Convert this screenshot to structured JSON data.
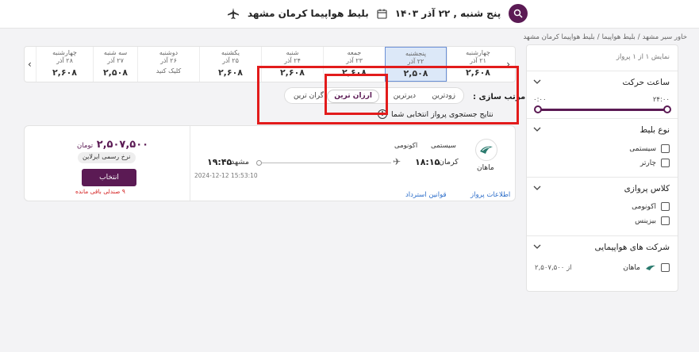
{
  "header": {
    "title": "بلیط هواپیما کرمان مشهد",
    "date": "پنج شنبه , ۲۲ آذر ۱۴۰۳"
  },
  "breadcrumb": [
    "خاور سیر مشهد",
    "/",
    "بلیط هواپیما",
    "/",
    "بلیط هواپیما کرمان مشهد"
  ],
  "datestrip": {
    "days": [
      {
        "name": "چهارشنبه",
        "date": "۲۱ آذر",
        "price": "۲,۶۰۸"
      },
      {
        "name": "پنجشنبه",
        "date": "۲۲ آذر",
        "price": "۲,۵۰۸",
        "active": true
      },
      {
        "name": "جمعه",
        "date": "۲۳ آذر",
        "price": "۲,۶۰۸"
      },
      {
        "name": "شنبه",
        "date": "۲۴ آذر",
        "price": "۲,۶۰۸"
      },
      {
        "name": "یکشنبه",
        "date": "۲۵ آذر",
        "price": "۲,۶۰۸"
      },
      {
        "name": "دوشنبه",
        "date": "۲۶ آذر",
        "price": "کلیک کنید",
        "small": true
      },
      {
        "name": "سه شنبه",
        "date": "۲۷ آذر",
        "price": "۲,۵۰۸"
      },
      {
        "name": "چهارشنبه",
        "date": "۲۸ آذر",
        "price": "۲,۶۰۸"
      }
    ],
    "prev_arrow": "‹",
    "next_arrow": "›"
  },
  "sort": {
    "label": "مرتب سازی :",
    "options": [
      "زودترین",
      "دیرترین",
      "ارزان ترین",
      "گران ترین"
    ],
    "active": "ارزان ترین"
  },
  "result_note": "نتایج جستجوی پرواز انتخابی شما",
  "sidebar": {
    "count": "نمایش ۱ از ۱ پرواز",
    "time": {
      "title": "ساعت حرکت",
      "min": "۰:۰۰",
      "max": "۲۴:۰۰"
    },
    "ticket_type": {
      "title": "نوع بلیط",
      "options": [
        "سیستمی",
        "چارتر"
      ]
    },
    "flight_class": {
      "title": "کلاس پروازی",
      "options": [
        "اکونومی",
        "بیزینس"
      ]
    },
    "airlines": {
      "title": "شرکت های هواپیمایی",
      "items": [
        {
          "name": "ماهان",
          "price": "از ۲,۵۰۷,۵۰۰"
        }
      ]
    }
  },
  "flight": {
    "airline": "ماهان",
    "type": "سیستمی",
    "class": "اکونومی",
    "origin_city": "کرمان",
    "origin_time": "۱۸:۱۵",
    "dest_city": "مشهد",
    "dest_time": "۱۹:۴۵",
    "stamp": "2024-12-12 15:53:10",
    "links": [
      "اطلاعات پرواز",
      "قوانین استرداد"
    ],
    "price": "۲,۵۰۷,۵۰۰",
    "currency": "تومان",
    "fare_badge": "نرخ رسمی ایرلاین",
    "select_label": "انتخاب",
    "seats_left": "۹ صندلی باقی مانده"
  },
  "colors": {
    "brand": "#5b1a54",
    "highlight": "#e21b1b",
    "active_day": "#dce8f8",
    "link": "#2a6cc9"
  }
}
